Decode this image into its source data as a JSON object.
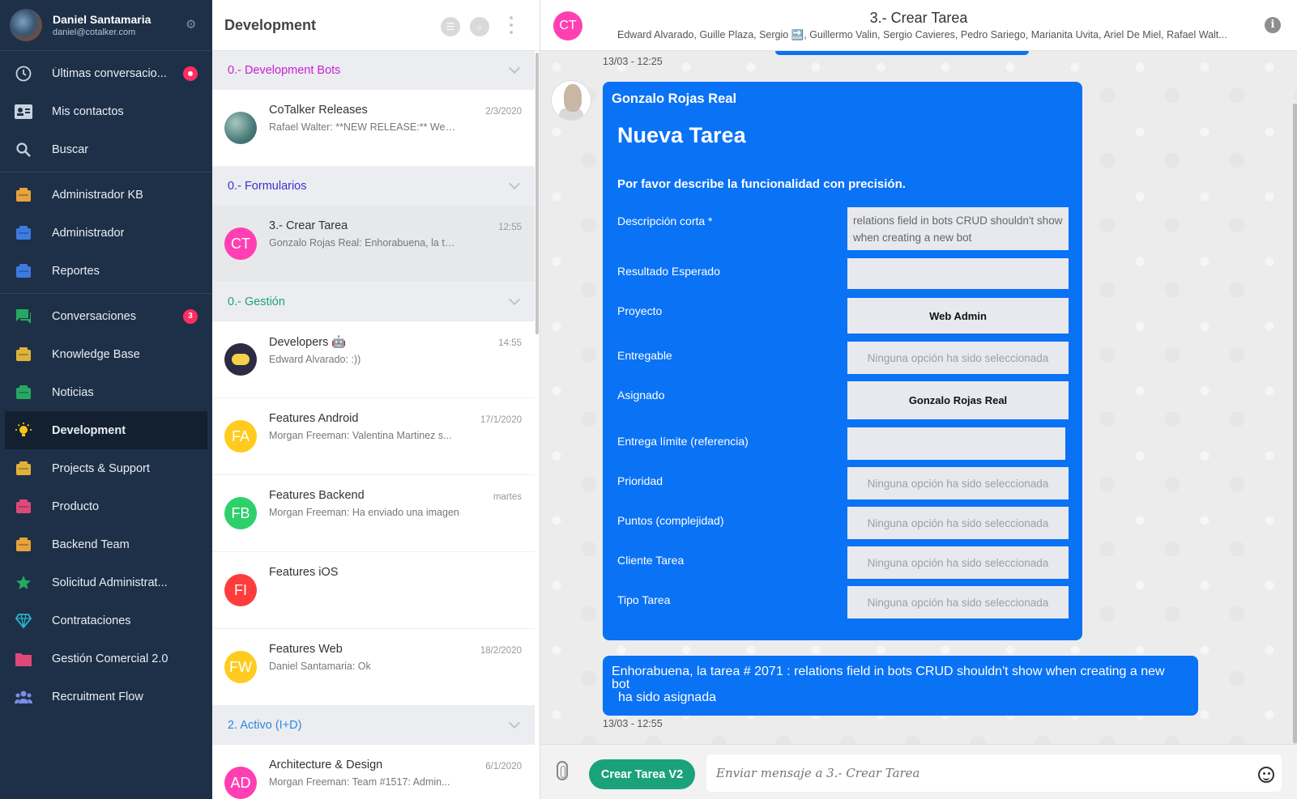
{
  "user": {
    "name": "Daniel Santamaria",
    "email": "daniel@cotalker.com"
  },
  "sidebar": {
    "items": [
      {
        "label": "Últimas conversacio...",
        "icon": "clock-icon",
        "color": "#c9d3de",
        "badge": ""
      },
      {
        "label": "Mis contactos",
        "icon": "contact-card-icon",
        "color": "#c9d3de"
      },
      {
        "label": "Buscar",
        "icon": "search-icon",
        "color": "#c9d3de"
      },
      {
        "label": "Administrador KB",
        "icon": "kb-admin-icon",
        "color": "#e8a33a"
      },
      {
        "label": "Administrador",
        "icon": "admin-icon",
        "color": "#3d7be0"
      },
      {
        "label": "Reportes",
        "icon": "report-icon",
        "color": "#3d7be0"
      },
      {
        "label": "Conversaciones",
        "icon": "chat-icon",
        "color": "#27a862",
        "badge": "3"
      },
      {
        "label": "Knowledge Base",
        "icon": "knowledge-icon",
        "color": "#e0b23a"
      },
      {
        "label": "Noticias",
        "icon": "news-icon",
        "color": "#27a862"
      },
      {
        "label": "Development",
        "icon": "bulb-icon",
        "color": "#f5c518",
        "active": true
      },
      {
        "label": "Projects & Support",
        "icon": "projects-icon",
        "color": "#e0b23a"
      },
      {
        "label": "Producto",
        "icon": "product-icon",
        "color": "#e0487a"
      },
      {
        "label": "Backend Team",
        "icon": "server-icon",
        "color": "#e8a33a"
      },
      {
        "label": "Solicitud Administrat...",
        "icon": "star-icon",
        "color": "#27a862"
      },
      {
        "label": "Contrataciones",
        "icon": "diamond-icon",
        "color": "#2ab3c8"
      },
      {
        "label": "Gestión Comercial 2.0",
        "icon": "folder-icon",
        "color": "#e0487a"
      },
      {
        "label": "Recruitment Flow",
        "icon": "people-icon",
        "color": "#7b8fe8"
      }
    ]
  },
  "list": {
    "title": "Development",
    "sections": [
      {
        "label": "0.- Development Bots",
        "color": "#c81ed6",
        "items": [
          {
            "title": "CoTalker Releases",
            "preview": "Rafael Walter: **NEW RELEASE:** Web ...",
            "time": "2/3/2020",
            "initials": "",
            "color": "#4a7a78"
          }
        ]
      },
      {
        "label": "0.- Formularios",
        "color": "#3a2fd0",
        "items": [
          {
            "title": "3.- Crear Tarea",
            "preview": "Gonzalo Rojas Real: Enhorabuena, la tarea ...",
            "time": "12:55",
            "initials": "CT",
            "color": "#ff3fb2",
            "selected": true
          }
        ]
      },
      {
        "label": "0.- Gestión",
        "color": "#1aa37a",
        "items": [
          {
            "title": "Developers 🤖",
            "preview": "Edward Alvarado: :))",
            "time": "14:55",
            "initials": "",
            "color": "#2b2b44"
          },
          {
            "title": "Features Android",
            "preview": "Morgan Freeman: Valentina Martinez s...",
            "time": "17/1/2020",
            "initials": "FA",
            "color": "#ffcb1f"
          },
          {
            "title": "Features Backend",
            "preview": "Morgan Freeman: Ha enviado una imagen",
            "time": "martes",
            "initials": "FB",
            "color": "#2ed06a"
          },
          {
            "title": "Features iOS",
            "preview": "",
            "time": "",
            "initials": "FI",
            "color": "#ff3b3b"
          },
          {
            "title": "Features Web",
            "preview": "Daniel Santamaria: Ok",
            "time": "18/2/2020",
            "initials": "FW",
            "color": "#ffcb1f"
          }
        ]
      },
      {
        "label": "2. Activo (I+D)",
        "color": "#2f86e0",
        "items": [
          {
            "title": "Architecture & Design",
            "preview": "Morgan Freeman: Team #1517: Admin...",
            "time": "6/1/2020",
            "initials": "AD",
            "color": "#ff3fb2"
          }
        ]
      }
    ]
  },
  "chat": {
    "initials": "CT",
    "title": "3.- Crear Tarea",
    "members": "Edward Alvarado, Guille Plaza, Sergio 🔜, Guillermo Valin, Sergio Cavieres, Pedro Sariego, Marianita Uvita, Ariel De Miel, Rafael Walt...",
    "prev_time": "13/03 - 12:25",
    "form": {
      "sender": "Gonzalo Rojas Real",
      "title": "Nueva Tarea",
      "description": "Por favor describe la funcionalidad con precisión.",
      "fields": [
        {
          "label": "Descripción corta *",
          "value": "relations field in bots CRUD shouldn't show when creating a new bot",
          "kind": "text"
        },
        {
          "label": "Resultado Esperado",
          "value": "",
          "kind": "empty"
        },
        {
          "label": "Proyecto",
          "value": "Web Admin",
          "kind": "bold"
        },
        {
          "label": "Entregable",
          "value": "Ninguna opción ha sido seleccionada",
          "kind": "placeholder"
        },
        {
          "label": "Asignado",
          "value": "Gonzalo Rojas Real",
          "kind": "bold"
        },
        {
          "label": "Entrega límite (referencia)",
          "value": "",
          "kind": "empty"
        },
        {
          "label": "Prioridad",
          "value": "Ninguna opción ha sido seleccionada",
          "kind": "placeholder"
        },
        {
          "label": "Puntos (complejidad)",
          "value": "Ninguna opción ha sido seleccionada",
          "kind": "placeholder"
        },
        {
          "label": "Cliente Tarea",
          "value": "Ninguna opción ha sido seleccionada",
          "kind": "placeholder"
        },
        {
          "label": "Tipo Tarea",
          "value": "Ninguna opción ha sido seleccionada",
          "kind": "placeholder"
        }
      ]
    },
    "reply": {
      "line1": "Enhorabuena, la tarea  # 2071  :  relations field in bots CRUD shouldn't show when creating a new",
      "line2": "bot",
      "line3": "ha sido asignada"
    },
    "reply_time": "13/03 - 12:55",
    "bot_button": "Crear Tarea V2",
    "input_placeholder": "Enviar mensaje a 3.- Crear Tarea"
  },
  "colors": {
    "sidebar_bg": "#1e3047",
    "bubble": "#0a72f5",
    "bot_button": "#1aa37a",
    "badge": "#ff2d62"
  }
}
